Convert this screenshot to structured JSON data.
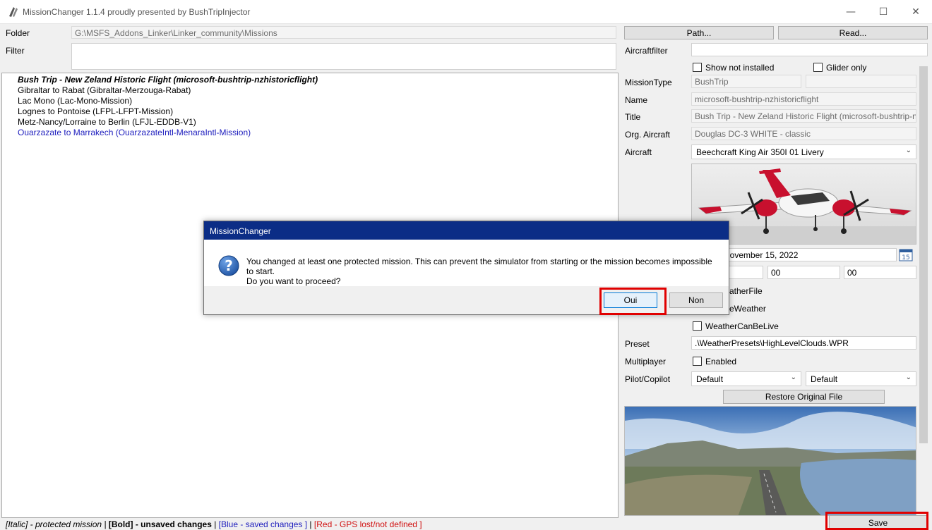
{
  "window": {
    "title": "MissionChanger 1.1.4 proudly presented by BushTripInjector",
    "minimize": "—",
    "maximize": "☐",
    "close": "✕"
  },
  "left": {
    "folder_label": "Folder",
    "folder_value": "G:\\MSFS_Addons_Linker\\Linker_community\\Missions",
    "filter_label": "Filter",
    "filter_value": ""
  },
  "toolbar": {
    "path_button": "Path...",
    "read_button": "Read..."
  },
  "missions": [
    {
      "text": "Bush Trip - New Zeland Historic Flight (microsoft-bushtrip-nzhistoricflight)",
      "style": "bold-italic"
    },
    {
      "text": "Gibraltar to Rabat (Gibraltar-Merzouga-Rabat)",
      "style": "normal"
    },
    {
      "text": "Lac Mono (Lac-Mono-Mission)",
      "style": "normal"
    },
    {
      "text": "Lognes to Pontoise (LFPL-LFPT-Mission)",
      "style": "normal"
    },
    {
      "text": "Metz-Nancy/Lorraine to Berlin (LFJL-EDDB-V1)",
      "style": "normal"
    },
    {
      "text": "Ouarzazate to Marrakech (OuarzazateIntl-MenaraIntl-Mission)",
      "style": "blue"
    }
  ],
  "details": {
    "aircraftfilter_label": "Aircraftfilter",
    "aircraftfilter_value": "",
    "show_not_installed_label": "Show not installed",
    "glider_only_label": "Glider only",
    "missiontype_label": "MissionType",
    "missiontype_value": "BushTrip",
    "missiontype_extra": "",
    "name_label": "Name",
    "name_value": "microsoft-bushtrip-nzhistoricflight",
    "title_label": "Title",
    "title_value": "Bush Trip - New Zeland Historic Flight (microsoft-bushtrip-nzhi",
    "org_aircraft_label": "Org. Aircraft",
    "org_aircraft_value": "Douglas DC-3 WHITE - classic",
    "aircraft_label": "Aircraft",
    "aircraft_value": "Beechcraft King Air 350I 01 Livery",
    "date_value": "November 15, 2022",
    "calendar_day": "15",
    "time_minutes": "00",
    "time_seconds": "00",
    "weatherfile_partial": "atherFile",
    "liveweather_partial": "eWeather",
    "weathercanbelive_label": "WeatherCanBeLive",
    "preset_label": "Preset",
    "preset_value": ".\\WeatherPresets\\HighLevelClouds.WPR",
    "multiplayer_label": "Multiplayer",
    "multiplayer_enabled_label": "Enabled",
    "pilot_copilot_label": "Pilot/Copilot",
    "pilot_value": "Default",
    "copilot_value": "Default",
    "restore_button": "Restore Original File",
    "save_button": "Save"
  },
  "status": {
    "italic": "[Italic]",
    "italic_desc": " - protected mission | ",
    "bold": "[Bold] - unsaved changes",
    "sep1": " | ",
    "blue": "[Blue - saved changes ]",
    "sep2": " | ",
    "red": "[Red - GPS lost/not defined ]",
    "blue_color": "#1d1dbd",
    "red_color": "#d01010"
  },
  "dialog": {
    "title": "MissionChanger",
    "line1": "You changed at least one protected mission. This can prevent the simulator from starting or the mission becomes impossible to start.",
    "line2": "Do you want to proceed?",
    "yes_button": "Oui",
    "no_button": "Non"
  }
}
